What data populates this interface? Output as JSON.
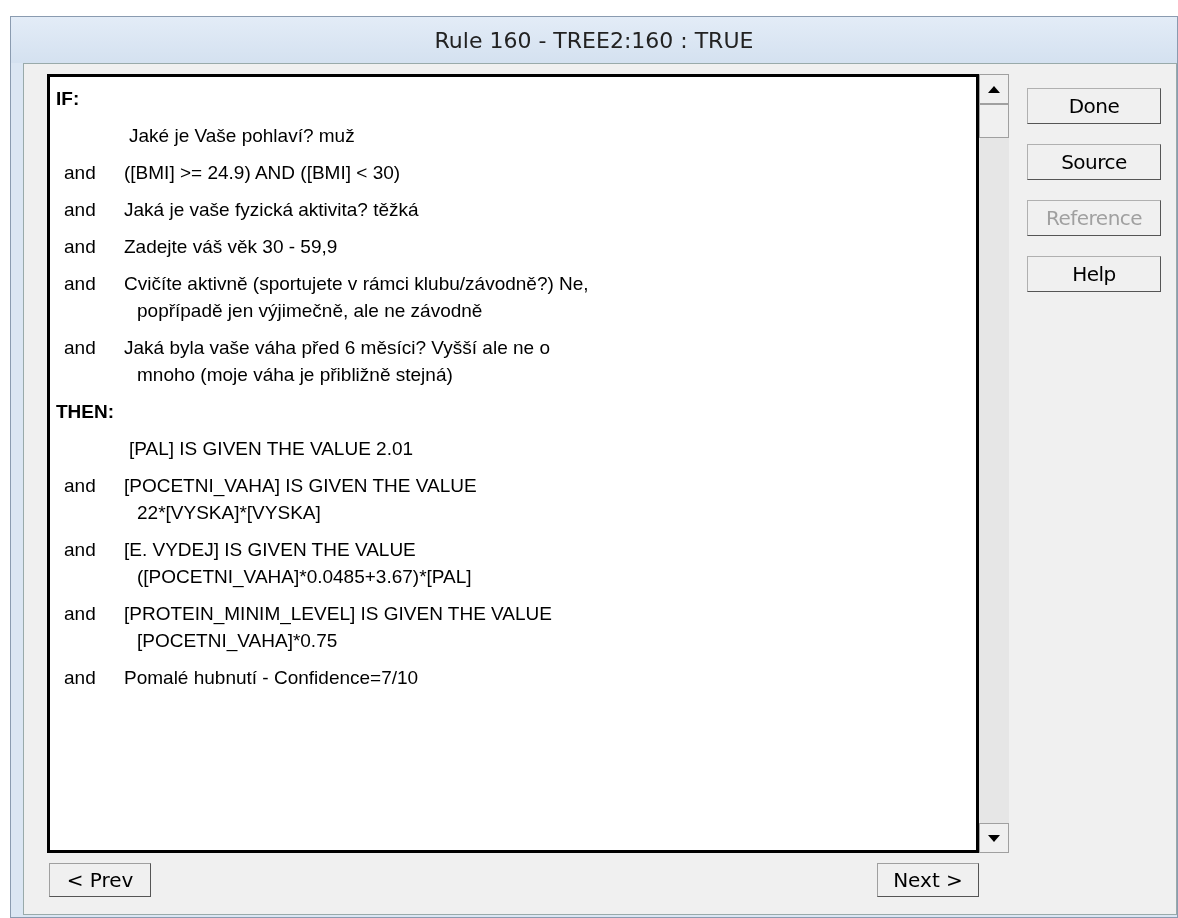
{
  "window": {
    "title": "Rule 160 - TREE2:160 : TRUE"
  },
  "sections": [
    {
      "heading": "IF:",
      "clauses": [
        {
          "lines": [
            "Jaké je Vaše pohlaví? muž"
          ]
        },
        {
          "connector": "and",
          "lines": [
            "([BMI] >= 24.9) AND ([BMI] < 30)"
          ]
        },
        {
          "connector": "and",
          "lines": [
            "Jaká je vaše fyzická aktivita? těžká"
          ]
        },
        {
          "connector": "and",
          "lines": [
            "Zadejte váš věk 30 - 59,9"
          ]
        },
        {
          "connector": "and",
          "lines": [
            "Cvičíte aktivně (sportujete v rámci klubu/závodně?) Ne,",
            "popřípadě jen výjimečně, ale ne závodně"
          ]
        },
        {
          "connector": "and",
          "lines": [
            "Jaká byla vaše váha před 6 měsíci? Vyšší ale ne o",
            "mnoho (moje váha je přibližně stejná)"
          ]
        }
      ]
    },
    {
      "heading": "THEN:",
      "clauses": [
        {
          "lines": [
            "[PAL] IS GIVEN THE VALUE 2.01"
          ]
        },
        {
          "connector": "and",
          "lines": [
            "[POCETNI_VAHA] IS GIVEN THE VALUE",
            "22*[VYSKA]*[VYSKA]"
          ]
        },
        {
          "connector": "and",
          "lines": [
            "[E. VYDEJ] IS GIVEN THE VALUE",
            "([POCETNI_VAHA]*0.0485+3.67)*[PAL]"
          ]
        },
        {
          "connector": "and",
          "lines": [
            "[PROTEIN_MINIM_LEVEL] IS GIVEN THE VALUE",
            "[POCETNI_VAHA]*0.75"
          ]
        },
        {
          "connector": "and",
          "lines": [
            "Pomalé hubnutí - Confidence=7/10"
          ]
        }
      ]
    }
  ],
  "side_buttons": [
    {
      "label": "Done",
      "disabled": false
    },
    {
      "label": "Source",
      "disabled": false
    },
    {
      "label": "Reference",
      "disabled": true
    },
    {
      "label": "Help",
      "disabled": false
    }
  ],
  "nav": {
    "prev": "< Prev",
    "next": "Next >"
  }
}
